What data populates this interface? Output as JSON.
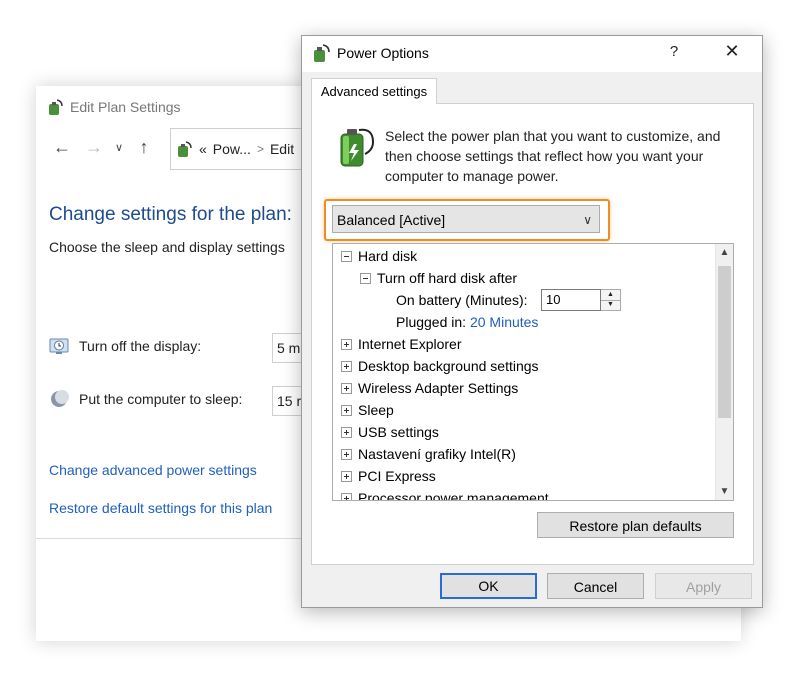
{
  "back_window": {
    "title": "Edit Plan Settings",
    "address_prefix": "«",
    "address_part1": "Pow...",
    "address_sep": ">",
    "address_part2": "Edit",
    "heading": "Change settings for the plan:",
    "subtext": "Choose the sleep and display settings",
    "display_label": "Turn off the display:",
    "display_value": "5 m",
    "sleep_label": "Put the computer to sleep:",
    "sleep_value": "15 r",
    "advanced_link": "Change advanced power settings",
    "restore_link": "Restore default settings for this plan"
  },
  "dialog": {
    "title": "Power Options",
    "help": "?",
    "close": "✕",
    "tab": "Advanced settings",
    "description": "Select the power plan that you want to customize, and then choose settings that reflect how you want your computer to manage power.",
    "plan_select": "Balanced [Active]",
    "tree": {
      "hard_disk": "Hard disk",
      "turn_off_after": "Turn off hard disk after",
      "on_battery_label": "On battery (Minutes):",
      "on_battery_value": "10",
      "plugged_label": "Plugged in:",
      "plugged_value": "20 Minutes",
      "items": [
        "Internet Explorer",
        "Desktop background settings",
        "Wireless Adapter Settings",
        "Sleep",
        "USB settings",
        "Nastavení grafiky Intel(R)",
        "PCI Express",
        "Processor power management"
      ]
    },
    "restore_button": "Restore plan defaults",
    "ok": "OK",
    "cancel": "Cancel",
    "apply": "Apply"
  }
}
